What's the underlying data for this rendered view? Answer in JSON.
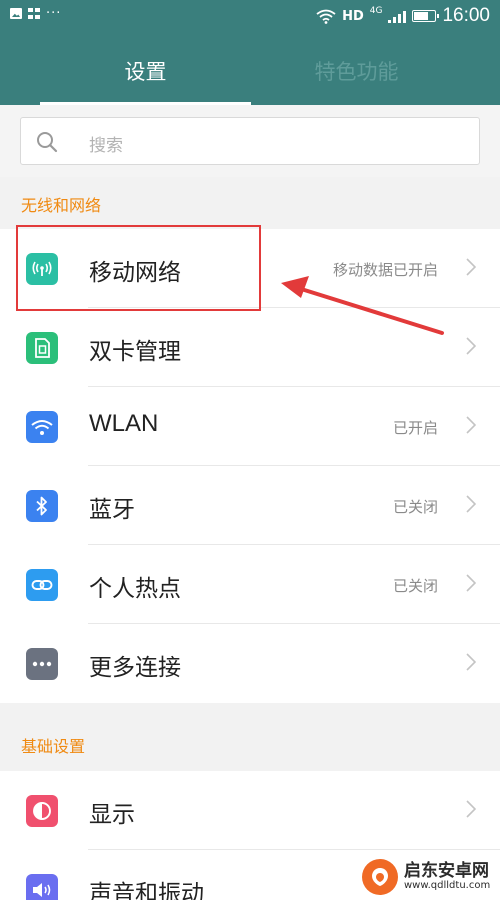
{
  "status_bar": {
    "dots": "···",
    "hd": "HD",
    "network": "4G",
    "time": "16:00"
  },
  "tabs": [
    {
      "label": "设置",
      "active": true
    },
    {
      "label": "特色功能",
      "active": false
    }
  ],
  "search": {
    "placeholder": "搜索"
  },
  "sections": [
    {
      "title": "无线和网络",
      "items": [
        {
          "label": "移动网络",
          "value": "移动数据已开启",
          "icon": "signal-broadcast-icon",
          "color": "#2bbfa4"
        },
        {
          "label": "双卡管理",
          "value": "",
          "icon": "sim-card-icon",
          "color": "#2bbf7a"
        },
        {
          "label": "WLAN",
          "value": "已开启",
          "icon": "wifi-icon",
          "color": "#3b82f0"
        },
        {
          "label": "蓝牙",
          "value": "已关闭",
          "icon": "bluetooth-icon",
          "color": "#3b82f0"
        },
        {
          "label": "个人热点",
          "value": "已关闭",
          "icon": "hotspot-link-icon",
          "color": "#2d9cf0"
        },
        {
          "label": "更多连接",
          "value": "",
          "icon": "more-dots-icon",
          "color": "#6b7280"
        }
      ]
    },
    {
      "title": "基础设置",
      "items": [
        {
          "label": "显示",
          "value": "",
          "icon": "display-icon",
          "color": "#f0506e"
        },
        {
          "label": "声音和振动",
          "value": "",
          "icon": "sound-icon",
          "color": "#6a6ef0"
        }
      ]
    }
  ],
  "watermark": {
    "cn": "启东安卓网",
    "url": "www.qdlldtu.com"
  },
  "colors": {
    "header": "#3a7f7d",
    "section_title": "#f08a12",
    "annotation_red": "#e23a3a"
  }
}
